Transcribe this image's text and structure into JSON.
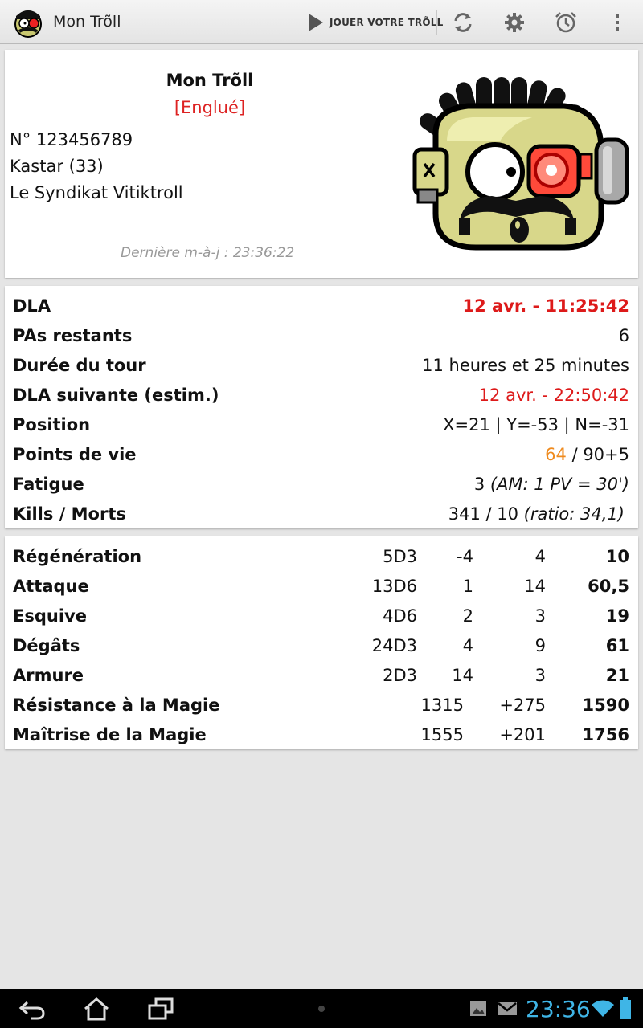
{
  "actionbar": {
    "title": "Mon Trõll",
    "play_label": "JOUER VOTRE TRÕLL",
    "icons": [
      "refresh-icon",
      "settings-gear-icon",
      "alarm-clock-icon",
      "overflow-menu-icon"
    ]
  },
  "profile": {
    "name": "Mon Trõll",
    "status": "[Englué]",
    "number": "N° 123456789",
    "race_level": "Kastar (33)",
    "guild": "Le Syndikat Vitiktroll",
    "last_update": "Dernière m-à-j : 23:36:22"
  },
  "info": {
    "rows": [
      {
        "label": "DLA",
        "value": "12 avr. - 11:25:42"
      },
      {
        "label": "PAs restants",
        "value": "6"
      },
      {
        "label": "Durée du tour",
        "value": "11 heures et 25 minutes"
      },
      {
        "label": "DLA suivante (estim.)",
        "value": "12 avr. - 22:50:42"
      },
      {
        "label": "Position",
        "value": "X=21 | Y=-53 | N=-31"
      },
      {
        "label": "Points de vie",
        "value_current": "64",
        "value_rest": " / 90+5"
      },
      {
        "label": "Fatigue",
        "value_main": "3 ",
        "value_note": "(AM: 1 PV = 30')"
      },
      {
        "label": "Kills / Morts",
        "value_main": "341 / 10 ",
        "value_note": "(ratio: 34,1)"
      }
    ]
  },
  "stats": {
    "dice_rows": [
      {
        "label": "Régénération",
        "dice": "5D3",
        "bonus": "-4",
        "mod": "4",
        "total": "10"
      },
      {
        "label": "Attaque",
        "dice": "13D6",
        "bonus": "1",
        "mod": "14",
        "total": "60,5"
      },
      {
        "label": "Esquive",
        "dice": "4D6",
        "bonus": "2",
        "mod": "3",
        "total": "19"
      },
      {
        "label": "Dégâts",
        "dice": "24D3",
        "bonus": "4",
        "mod": "9",
        "total": "61"
      },
      {
        "label": "Armure",
        "dice": "2D3",
        "bonus": "14",
        "mod": "3",
        "total": "21"
      }
    ],
    "magic_rows": [
      {
        "label": "Résistance à la Magie",
        "base": "1315",
        "bonus": "+275",
        "total": "1590"
      },
      {
        "label": "Maîtrise de la Magie",
        "base": "1555",
        "bonus": "+201",
        "total": "1756"
      }
    ]
  },
  "statusbar": {
    "time": "23:36",
    "icons": [
      "gallery-icon",
      "gmail-icon",
      "wifi-icon",
      "battery-icon"
    ]
  },
  "navbar": {
    "icons": [
      "back-icon",
      "home-icon",
      "recent-apps-icon"
    ]
  },
  "colors": {
    "accent_red": "#dd1a1a",
    "hp_orange": "#ef8a1d",
    "clock_blue": "#3fb5e6"
  }
}
